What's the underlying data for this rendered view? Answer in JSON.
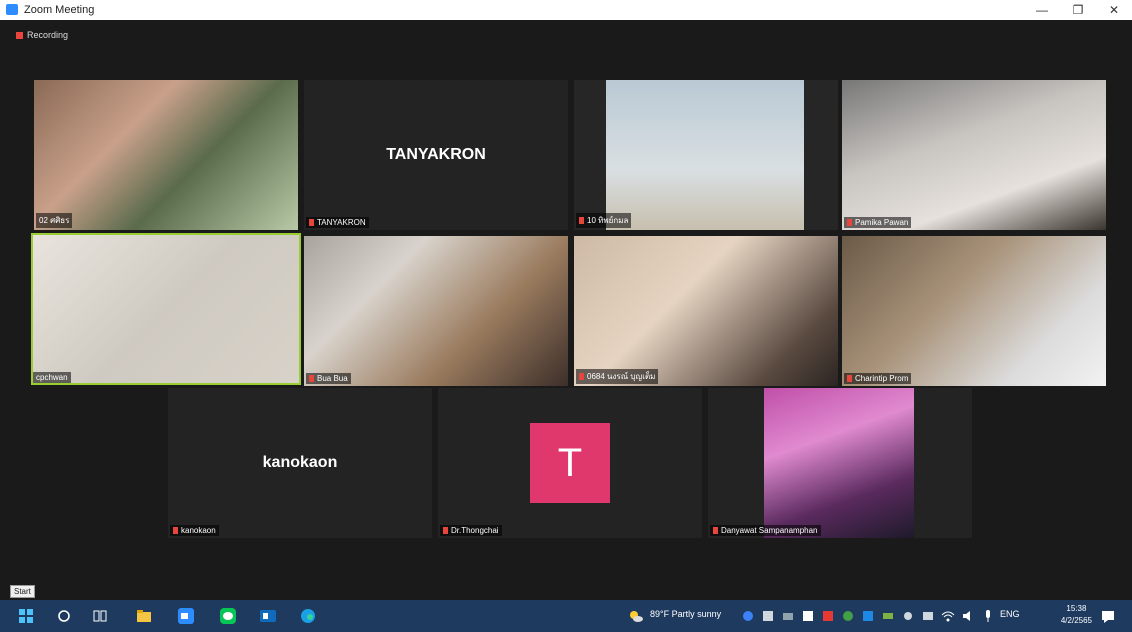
{
  "window": {
    "title": "Zoom Meeting",
    "minimize": "—",
    "maximize": "❐",
    "close": "✕"
  },
  "recording_label": "Recording",
  "participants": [
    {
      "name": "02 ศศิธร"
    },
    {
      "name": "TANYAKRON",
      "display": "TANYAKRON"
    },
    {
      "name": "10 ทิพย์กมล"
    },
    {
      "name": "Pamika Pawan"
    },
    {
      "name": "cpchwan"
    },
    {
      "name": "Bua Bua"
    },
    {
      "name": "0684 นงรณ์ บุญเต็ม"
    },
    {
      "name": "Charintip Prom"
    },
    {
      "name": "kanokaon",
      "display": "kanokaon"
    },
    {
      "name": "Dr.Thongchai",
      "avatar_letter": "T"
    },
    {
      "name": "Danyawat Sampanamphan"
    }
  ],
  "start_tooltip": "Start",
  "taskbar": {
    "weather": "89°F  Partly sunny",
    "lang": "ENG",
    "time": "15:38",
    "date": "4/2/2565"
  },
  "colors": {
    "accent_zoom": "#2d8cff",
    "active_speaker": "#9acd32",
    "avatar_bg": "#e0386c"
  }
}
